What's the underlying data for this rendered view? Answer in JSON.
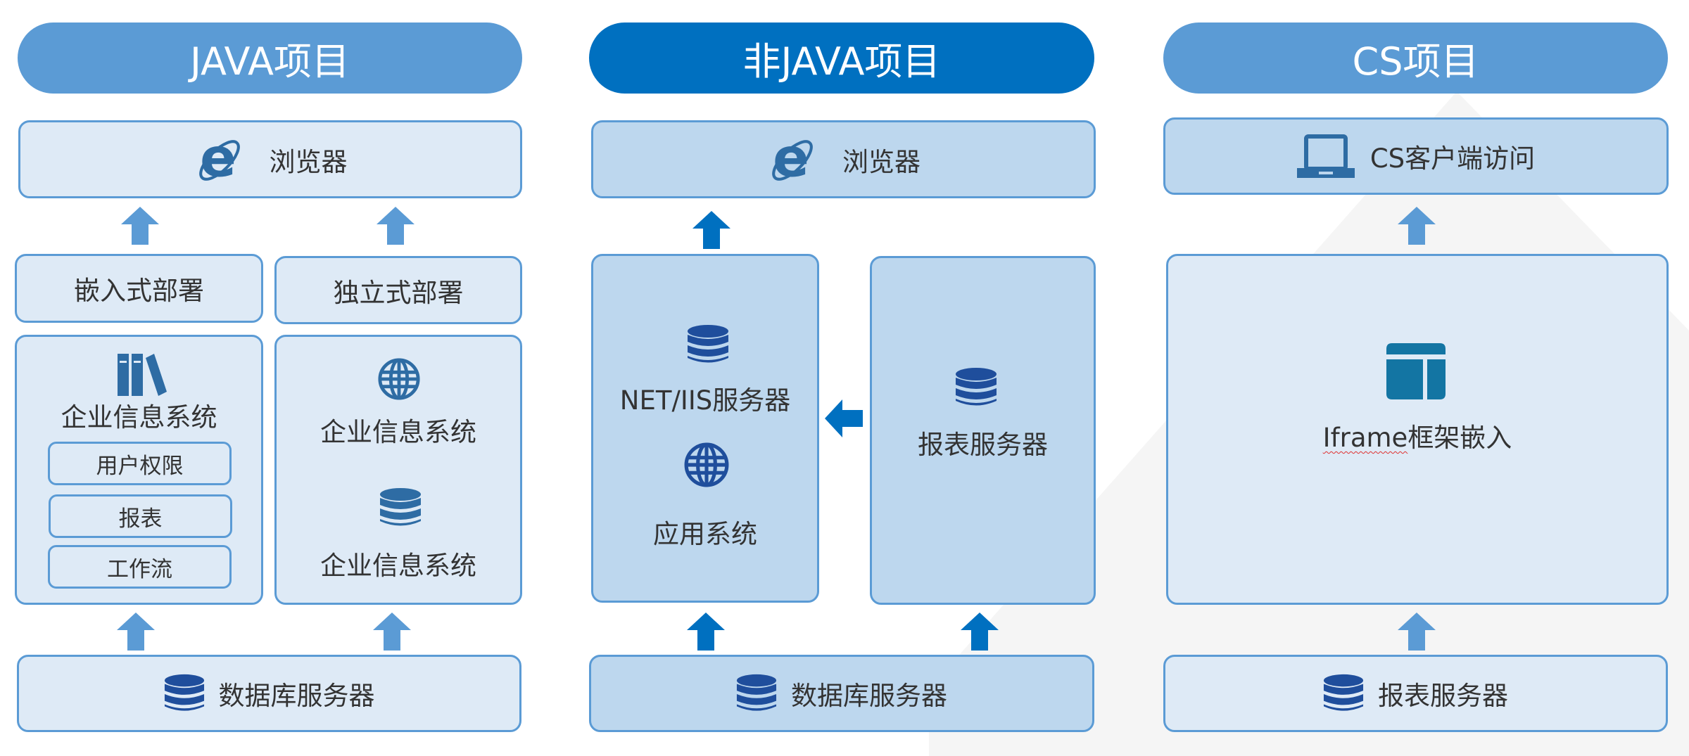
{
  "colors": {
    "pill": "#5b9bd5",
    "pill_active": "#0070c0",
    "border": "#5b9bd5",
    "fill_light": "#deeaf6",
    "fill_mid": "#bdd7ee",
    "icon": "#2e6ca4",
    "db_icon": "#1f4e9c"
  },
  "java": {
    "title": "JAVA项目",
    "browser": {
      "label": "浏览器",
      "icon": "ie-browser-icon"
    },
    "embedded": {
      "label": "嵌入式部署"
    },
    "standalone": {
      "label": "独立式部署"
    },
    "embedded_system": {
      "label": "企业信息系统",
      "icon": "books-icon",
      "modules": [
        "用户权限",
        "报表",
        "工作流"
      ]
    },
    "standalone_system": {
      "web_label": "企业信息系统",
      "web_icon": "globe-icon",
      "db_label": "企业信息系统",
      "db_icon": "database-icon"
    },
    "database": {
      "label": "数据库服务器",
      "icon": "database-icon"
    }
  },
  "non_java": {
    "title": "非JAVA项目",
    "browser": {
      "label": "浏览器",
      "icon": "ie-browser-icon"
    },
    "net_server": {
      "label": "NET/IIS服务器",
      "icon": "database-icon",
      "app_label": "应用系统",
      "app_icon": "globe-icon"
    },
    "report_server": {
      "label": "报表服务器",
      "icon": "database-icon"
    },
    "database": {
      "label": "数据库服务器",
      "icon": "database-icon"
    }
  },
  "cs": {
    "title": "CS项目",
    "client": {
      "label": "CS客户端访问",
      "icon": "laptop-icon"
    },
    "iframe": {
      "label_latin": "Iframe",
      "label_rest": "框架嵌入",
      "icon": "layout-icon"
    },
    "report_server": {
      "label": "报表服务器",
      "icon": "database-icon"
    }
  }
}
